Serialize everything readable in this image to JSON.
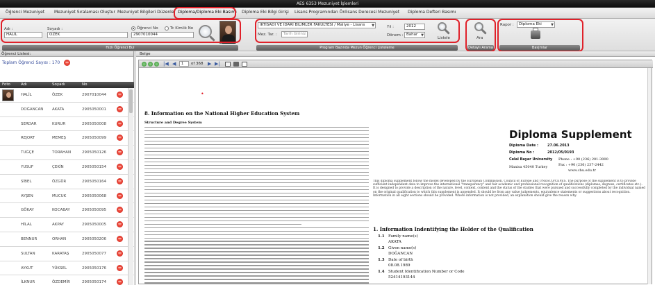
{
  "window": {
    "title": "AES 6353 Mezuniyet İşlemleri"
  },
  "menu": [
    {
      "label": "Öğrenci Mezuniyet"
    },
    {
      "label": "Mezuniyet Sıralaması Oluştur"
    },
    {
      "label": "Mezuniyet Bilgileri Düzenle"
    },
    {
      "label": "Diploma/Diploma Eki Basımı"
    },
    {
      "label": "Diploma Eki Bilgi Girişi"
    },
    {
      "label": "Lisans Programından Önlisans Derecesi Mezuniyet"
    },
    {
      "label": "Diploma Defteri Basımı"
    }
  ],
  "search": {
    "name_label": "Adı :",
    "surname_label": "Soyadı :",
    "name_value": "HALİL",
    "surname_value": "ÖZEK",
    "radio_no": "Öğrenci No",
    "radio_tc": "Tc Kimlik No",
    "number_value": "2907010044",
    "group_label": "Hızlı Öğrenci Bul"
  },
  "program": {
    "faculty_value": "İKTİSADİ VE İDARİ BİLİMLER FAKÜLTESİ / Maliye - Lisans",
    "mez_label": "Mez. Tar. :",
    "mez_placeholder": "Tarih Giriniz",
    "year_label": "Yıl :",
    "year_value": "2012",
    "term_label": "Dönem :",
    "term_value": "Bahar",
    "list_label": "Listele",
    "group_label": "Program Bazında Mezun Öğrenci Listeleme"
  },
  "detail_search": {
    "button_label": "Ara",
    "group_label": "Detaylı Arama"
  },
  "report": {
    "label": "Rapor :",
    "value": "Diploma Eki",
    "group_label": "Bas|mlar"
  },
  "left_panel": {
    "title": "Öğrenci Listesi:",
    "count_label": "Toplam Öğrenci Sayısı : 170",
    "columns": [
      "Foto",
      "Adı",
      "Soyadı",
      "No"
    ],
    "rows": [
      {
        "name": "HALİL",
        "surname": "ÖZEK",
        "no": "2907010044"
      },
      {
        "name": "DOĞANCAN",
        "surname": "AKATA",
        "no": "2905050001"
      },
      {
        "name": "SERDAR",
        "surname": "KURUR",
        "no": "2905050008"
      },
      {
        "name": "REJORT",
        "surname": "MEMEŞ",
        "no": "2905050099"
      },
      {
        "name": "TUĞÇE",
        "surname": "TORAHAN",
        "no": "2905050126"
      },
      {
        "name": "YUSUF",
        "surname": "ÇEKİN",
        "no": "2905050154"
      },
      {
        "name": "SİBEL",
        "surname": "ÖZGÜR",
        "no": "2905050164"
      },
      {
        "name": "AYŞEN",
        "surname": "MUCUK",
        "no": "2905050068"
      },
      {
        "name": "GÖKAY",
        "surname": "KOCABAY",
        "no": "2905050095"
      },
      {
        "name": "HİLAL",
        "surname": "AKPAY",
        "no": "2905050005"
      },
      {
        "name": "BENNUR",
        "surname": "ORHAN",
        "no": "2905050206"
      },
      {
        "name": "SULTAN",
        "surname": "KARATAŞ",
        "no": "2905050077"
      },
      {
        "name": "AYKUT",
        "surname": "YÜKSEL",
        "no": "2905050176"
      },
      {
        "name": "İLKNUR",
        "surname": "ÖZDEMİR",
        "no": "2905050174"
      }
    ]
  },
  "right_panel": {
    "tab_label": "Belge",
    "page_value": "1",
    "page_total": "of 368"
  },
  "document": {
    "section_title": "8. Information on the National Higher Education System",
    "subheading": "Structure and Degree System",
    "diploma_title": "Diploma Supplement",
    "diploma_date_label": "Diploma Date :",
    "diploma_date": "27.06.2013",
    "diploma_no_label": "Diploma No :",
    "diploma_no": "2012/05/0193",
    "university": "Celal Bayar University",
    "phone": "Phone : +90 (236) 201-3000",
    "city": "Manisa 45040 Turkey",
    "fax": "Fax : +90 (236) 237-2442",
    "web": "www.cbu.edu.tr",
    "intro_text": "This diploma supplement follow the model developed by the European Commission, Council of Europe and UNESCO/CEPES. The purpose of the supplement is to provide sufficient independent data to improve the international \"transparency\" and fair academic and professional recognition of qualifications (diplomas, degrees, certificates etc.). It is designed to provide a description of the nature, level, context, content and the status of the studies that were pursued and successfully completed by the individual named on the original qualification to which this supplement is appended. It should be from any value judgements, equivalence statements or suggestions about recognition. Information in all eight sections should be provided. Where information is not provided, an explanation should give the reason why.",
    "holder_heading": "1. Information Indentifying the Holder of the Qualification",
    "fields": [
      {
        "num": "1.1",
        "label": "Family name(s)",
        "value": "AKATA"
      },
      {
        "num": "1.2",
        "label": "Given name(s)",
        "value": "DOĞANCAN"
      },
      {
        "num": "1.3",
        "label": "Date of birth",
        "value": "08.08.1989"
      },
      {
        "num": "1.4",
        "label": "Student Identification Number or Code",
        "value": "52414193144"
      }
    ]
  }
}
